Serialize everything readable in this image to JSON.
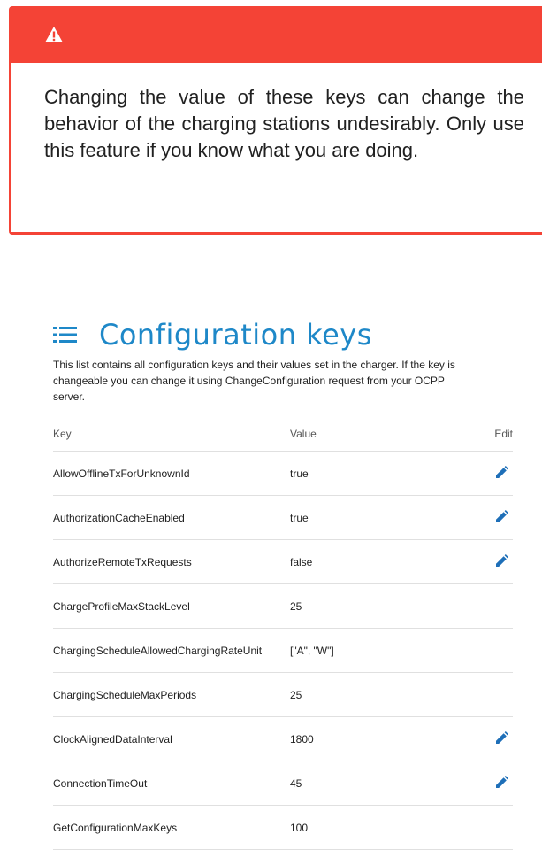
{
  "warning": {
    "icon": "warning-triangle-icon",
    "color": "#f44336",
    "text": "Changing the value of these keys can change the behavior of the charging stations undesirably. Only use this feature if you know what you are doing."
  },
  "section": {
    "icon": "list-icon",
    "title": "Configuration keys",
    "title_color": "#1e88c8",
    "description": "This list contains all configuration keys and their values set in the charger. If the key is changeable you can change it using ChangeConfiguration request from your OCPP server."
  },
  "table": {
    "headers": {
      "key": "Key",
      "value": "Value",
      "edit": "Edit"
    },
    "rows": [
      {
        "key": "AllowOfflineTxForUnknownId",
        "value": "true",
        "editable": true
      },
      {
        "key": "AuthorizationCacheEnabled",
        "value": "true",
        "editable": true
      },
      {
        "key": "AuthorizeRemoteTxRequests",
        "value": "false",
        "editable": true
      },
      {
        "key": "ChargeProfileMaxStackLevel",
        "value": "25",
        "editable": false
      },
      {
        "key": "ChargingScheduleAllowedChargingRateUnit",
        "value": "[\"A\", \"W\"]",
        "editable": false
      },
      {
        "key": "ChargingScheduleMaxPeriods",
        "value": "25",
        "editable": false
      },
      {
        "key": "ClockAlignedDataInterval",
        "value": "1800",
        "editable": true
      },
      {
        "key": "ConnectionTimeOut",
        "value": "45",
        "editable": true
      },
      {
        "key": "GetConfigurationMaxKeys",
        "value": "100",
        "editable": false
      }
    ],
    "edit_icon": "pencil-icon",
    "edit_icon_color": "#1e6fb8"
  }
}
